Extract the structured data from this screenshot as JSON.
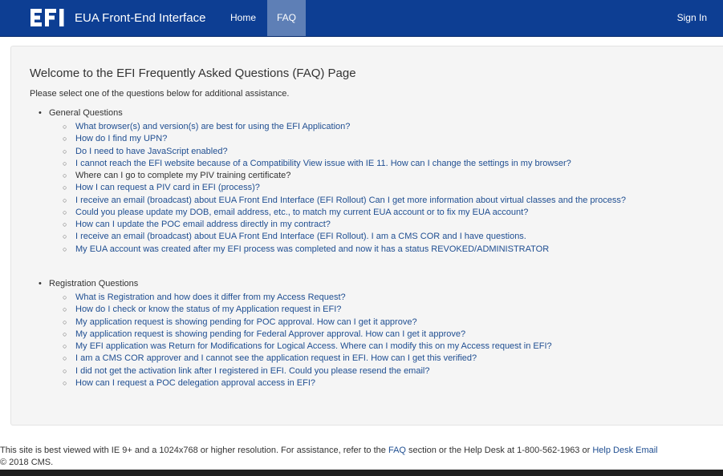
{
  "navbar": {
    "logo_text": "EFI",
    "brand": "EUA Front-End Interface",
    "home": "Home",
    "faq": "FAQ",
    "sign_in": "Sign In",
    "color": "#0d3e93",
    "active_color": "#5e7fb6"
  },
  "page": {
    "title": "Welcome to the EFI Frequently Asked Questions (FAQ) Page",
    "intro": "Please select one of the questions below for additional assistance."
  },
  "general": {
    "title": "General Questions",
    "questions": [
      "What browser(s) and version(s) are best for using the EFI Application?",
      "How do I find my UPN?",
      "Do I need to have JavaScript enabled?",
      "I cannot reach the EFI website because of a Compatibility View issue with IE 11. How can I change the settings in my browser?",
      "Where can I go to complete my PIV training certificate?",
      "How I can request a PIV card in EFI (process)?",
      "I receive an email (broadcast) about EUA Front End Interface (EFI Rollout) Can I get more information about virtual classes and the process?",
      "Could you please update my DOB, email address, etc., to match my current EUA account or to fix my EUA account?",
      "How can I update the POC email address directly in my contract?",
      "I receive an email (broadcast) about EUA Front End Interface (EFI Rollout). I am a CMS COR and I have questions.",
      "My EUA account was created after my EFI process was completed and now it has a status REVOKED/ADMINISTRATOR"
    ]
  },
  "registration": {
    "title": "Registration Questions",
    "questions": [
      "What is Registration and how does it differ from my Access Request?",
      "How do I check or know the status of my Application request in EFI?",
      "My application request is showing pending for POC approval. How can I get it approve?",
      "My application request is showing pending for Federal Approver approval. How can I get it approve?",
      "My EFI application was Return for Modifications for Logical Access. Where can I modify this on my Access request in EFI?",
      "I am a CMS COR approver and I cannot see the application request in EFI. How can I get this verified?",
      "I did not get the activation link after I registered in EFI. Could you please resend the email?",
      "How can I request a POC delegation approval access in EFI?"
    ]
  },
  "footer": {
    "text1": "This site is best viewed with IE 9+ and a 1024x768 or higher resolution. For assistance, refer to the ",
    "faq_link": "FAQ",
    "text2": " section or the Help Desk at 1-800-562-1963 or ",
    "help_link": "Help Desk Email",
    "copyright": "© 2018 CMS."
  }
}
